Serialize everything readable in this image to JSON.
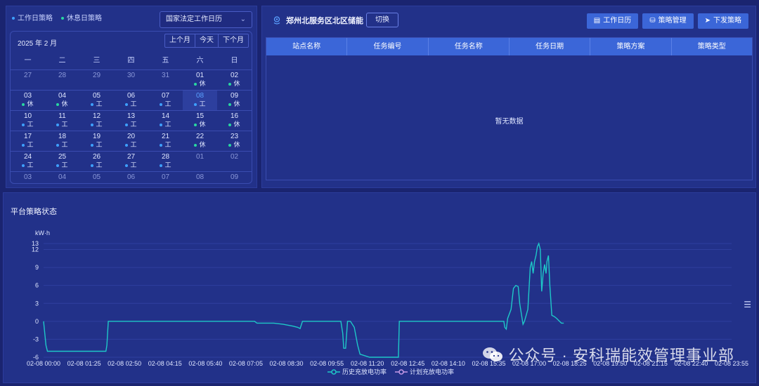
{
  "calendar": {
    "legend": {
      "work": "工作日策略",
      "rest": "休息日策略"
    },
    "selector": "国家法定工作日历",
    "month_label": "2025 年 2 月",
    "nav": {
      "prev": "上个月",
      "today": "今天",
      "next": "下个月"
    },
    "weekdays": [
      "一",
      "二",
      "三",
      "四",
      "五",
      "六",
      "日"
    ],
    "weeks": [
      [
        {
          "d": "27",
          "o": true
        },
        {
          "d": "28",
          "o": true
        },
        {
          "d": "29",
          "o": true
        },
        {
          "d": "30",
          "o": true
        },
        {
          "d": "31",
          "o": true
        },
        {
          "d": "01",
          "t": "休",
          "k": "rest"
        },
        {
          "d": "02",
          "t": "休",
          "k": "rest"
        }
      ],
      [
        {
          "d": "03",
          "t": "休",
          "k": "rest"
        },
        {
          "d": "04",
          "t": "休",
          "k": "rest"
        },
        {
          "d": "05",
          "t": "工",
          "k": "work"
        },
        {
          "d": "06",
          "t": "工",
          "k": "work"
        },
        {
          "d": "07",
          "t": "工",
          "k": "work"
        },
        {
          "d": "08",
          "t": "工",
          "k": "work",
          "sel": true
        },
        {
          "d": "09",
          "t": "休",
          "k": "rest"
        }
      ],
      [
        {
          "d": "10",
          "t": "工",
          "k": "work"
        },
        {
          "d": "11",
          "t": "工",
          "k": "work"
        },
        {
          "d": "12",
          "t": "工",
          "k": "work"
        },
        {
          "d": "13",
          "t": "工",
          "k": "work"
        },
        {
          "d": "14",
          "t": "工",
          "k": "work"
        },
        {
          "d": "15",
          "t": "休",
          "k": "rest"
        },
        {
          "d": "16",
          "t": "休",
          "k": "rest"
        }
      ],
      [
        {
          "d": "17",
          "t": "工",
          "k": "work"
        },
        {
          "d": "18",
          "t": "工",
          "k": "work"
        },
        {
          "d": "19",
          "t": "工",
          "k": "work"
        },
        {
          "d": "20",
          "t": "工",
          "k": "work"
        },
        {
          "d": "21",
          "t": "工",
          "k": "work"
        },
        {
          "d": "22",
          "t": "休",
          "k": "rest"
        },
        {
          "d": "23",
          "t": "休",
          "k": "rest"
        }
      ],
      [
        {
          "d": "24",
          "t": "工",
          "k": "work"
        },
        {
          "d": "25",
          "t": "工",
          "k": "work"
        },
        {
          "d": "26",
          "t": "工",
          "k": "work"
        },
        {
          "d": "27",
          "t": "工",
          "k": "work"
        },
        {
          "d": "28",
          "t": "工",
          "k": "work"
        },
        {
          "d": "01",
          "o": true
        },
        {
          "d": "02",
          "o": true
        }
      ],
      [
        {
          "d": "03",
          "o": true
        },
        {
          "d": "04",
          "o": true
        },
        {
          "d": "05",
          "o": true
        },
        {
          "d": "06",
          "o": true
        },
        {
          "d": "07",
          "o": true
        },
        {
          "d": "08",
          "o": true
        },
        {
          "d": "09",
          "o": true
        }
      ]
    ]
  },
  "task": {
    "station": "郑州北服务区北区储能",
    "switch": "切换",
    "buttons": [
      "工作日历",
      "策略管理",
      "下发策略"
    ],
    "columns": [
      "站点名称",
      "任务编号",
      "任务名称",
      "任务日期",
      "策略方案",
      "策略类型"
    ],
    "empty": "暂无数据"
  },
  "chart_title": "平台策略状态",
  "watermark": "公众号 · 安科瑞能效管理事业部",
  "colors": {
    "history": "#1ec8c8",
    "plan": "#c89ae8",
    "rest": "#28d7a0",
    "work": "#3ea0ff"
  },
  "chart_data": {
    "type": "line",
    "ylabel": "kW·h",
    "yticks": [
      -6,
      -3,
      0,
      3,
      6,
      9,
      12,
      13
    ],
    "ylim": [
      -6,
      13
    ],
    "xticks": [
      "02-08 00:00",
      "02-08 01:25",
      "02-08 02:50",
      "02-08 04:15",
      "02-08 05:40",
      "02-08 07:05",
      "02-08 08:30",
      "02-08 09:55",
      "02-08 11:20",
      "02-08 12:45",
      "02-08 14:10",
      "02-08 15:35",
      "02-08 17:00",
      "02-08 18:25",
      "02-08 19:50",
      "02-08 21:15",
      "02-08 22:40",
      "02-08 23:55"
    ],
    "xlim_minutes": [
      0,
      1435
    ],
    "series": [
      {
        "name": "历史充放电功率",
        "points": [
          [
            0,
            0
          ],
          [
            5,
            -4
          ],
          [
            8,
            -5
          ],
          [
            20,
            -5
          ],
          [
            130,
            -5
          ],
          [
            132,
            -4
          ],
          [
            135,
            0
          ],
          [
            440,
            0
          ],
          [
            445,
            -0.3
          ],
          [
            480,
            -0.3
          ],
          [
            500,
            -0.5
          ],
          [
            520,
            -0.8
          ],
          [
            530,
            -1
          ],
          [
            535,
            -1.2
          ],
          [
            538,
            -0.5
          ],
          [
            540,
            0
          ],
          [
            620,
            0
          ],
          [
            624,
            -2
          ],
          [
            626,
            -4.5
          ],
          [
            630,
            -4.5
          ],
          [
            634,
            0
          ],
          [
            640,
            0
          ],
          [
            648,
            -1
          ],
          [
            655,
            -4
          ],
          [
            660,
            -5.5
          ],
          [
            680,
            -6
          ],
          [
            740,
            -6
          ],
          [
            742,
            0
          ],
          [
            960,
            0
          ],
          [
            962,
            -1
          ],
          [
            965,
            -1.3
          ],
          [
            968,
            0.5
          ],
          [
            975,
            2
          ],
          [
            980,
            5.5
          ],
          [
            985,
            6
          ],
          [
            990,
            5.8
          ],
          [
            993,
            3
          ],
          [
            997,
            1
          ],
          [
            1000,
            -0.5
          ],
          [
            1003,
            0
          ],
          [
            1010,
            2
          ],
          [
            1015,
            9
          ],
          [
            1018,
            10
          ],
          [
            1021,
            8
          ],
          [
            1024,
            10
          ],
          [
            1027,
            11
          ],
          [
            1030,
            12.5
          ],
          [
            1033,
            13
          ],
          [
            1036,
            12
          ],
          [
            1039,
            5
          ],
          [
            1042,
            8
          ],
          [
            1045,
            9.5
          ],
          [
            1048,
            8
          ],
          [
            1050,
            10
          ],
          [
            1053,
            11
          ],
          [
            1056,
            6
          ],
          [
            1060,
            1
          ],
          [
            1065,
            0.8
          ],
          [
            1070,
            0.5
          ],
          [
            1076,
            0
          ],
          [
            1080,
            -0.3
          ],
          [
            1085,
            -0.3
          ]
        ]
      },
      {
        "name": "计划充放电功率",
        "points": []
      }
    ]
  }
}
